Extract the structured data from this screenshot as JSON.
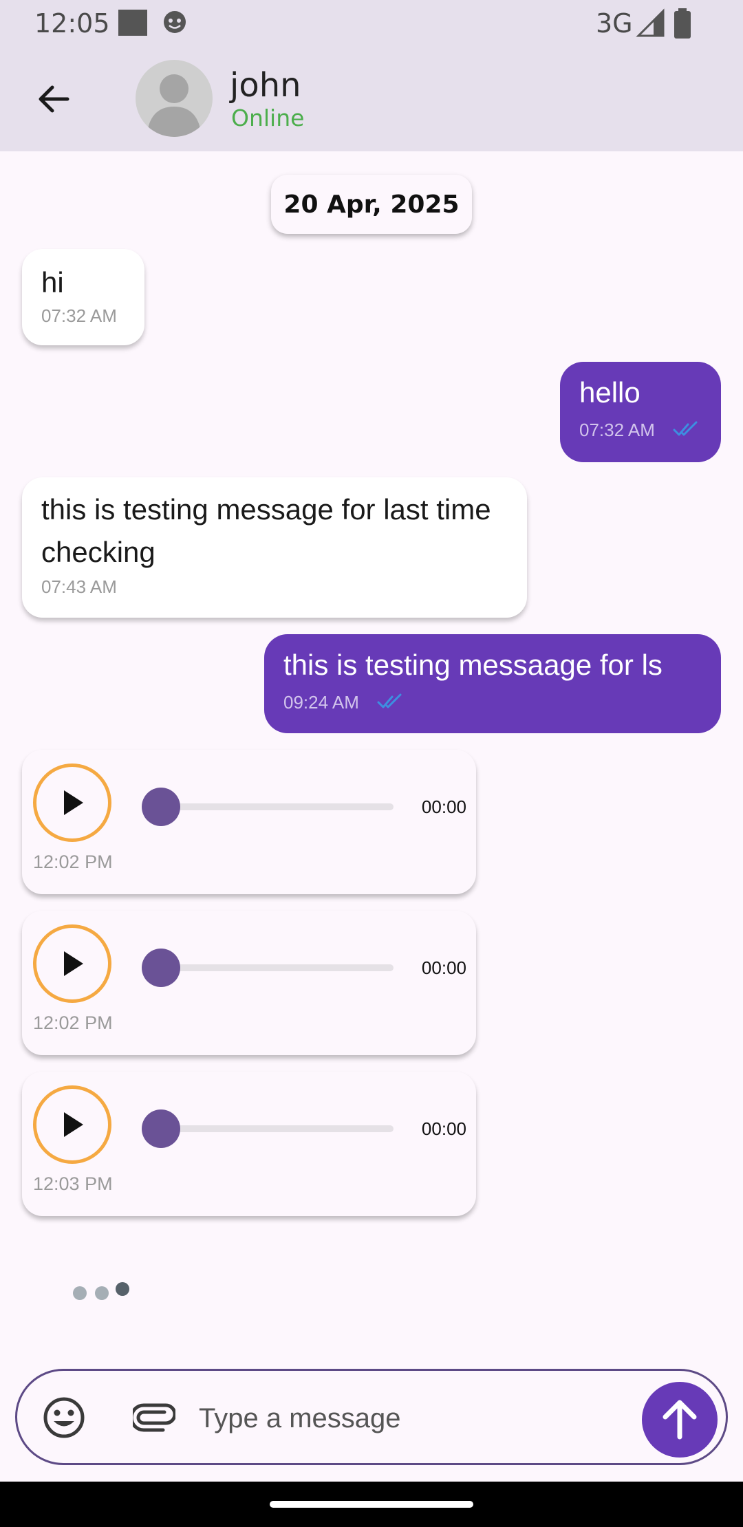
{
  "status_bar": {
    "time": "12:05",
    "network": "3G"
  },
  "header": {
    "contact_name": "john",
    "status": "Online"
  },
  "date_separator": "20 Apr, 2025",
  "messages": [
    {
      "direction": "incoming",
      "text": "hi",
      "time": "07:32 AM"
    },
    {
      "direction": "outgoing",
      "text": "hello",
      "time": "07:32 AM",
      "read": true
    },
    {
      "direction": "incoming",
      "text": "this is testing message for last time checking",
      "time": "07:43 AM"
    },
    {
      "direction": "outgoing",
      "text": "this is testing messaage for ls",
      "time": "09:24 AM",
      "read": true
    }
  ],
  "voice_messages": [
    {
      "duration": "00:00",
      "time": "12:02 PM",
      "progress": 0
    },
    {
      "duration": "00:00",
      "time": "12:02 PM",
      "progress": 0
    },
    {
      "duration": "00:00",
      "time": "12:03 PM",
      "progress": 0
    }
  ],
  "composer": {
    "placeholder": "Type a message"
  },
  "colors": {
    "accent": "#673ab7",
    "online": "#4cae4c",
    "play_ring": "#f5a942",
    "read_ticks": "#3d8fe0"
  },
  "icons": [
    "back-arrow-icon",
    "avatar-placeholder",
    "double-check-icon",
    "play-icon",
    "emoji-icon",
    "attach-icon",
    "send-arrow-icon"
  ]
}
